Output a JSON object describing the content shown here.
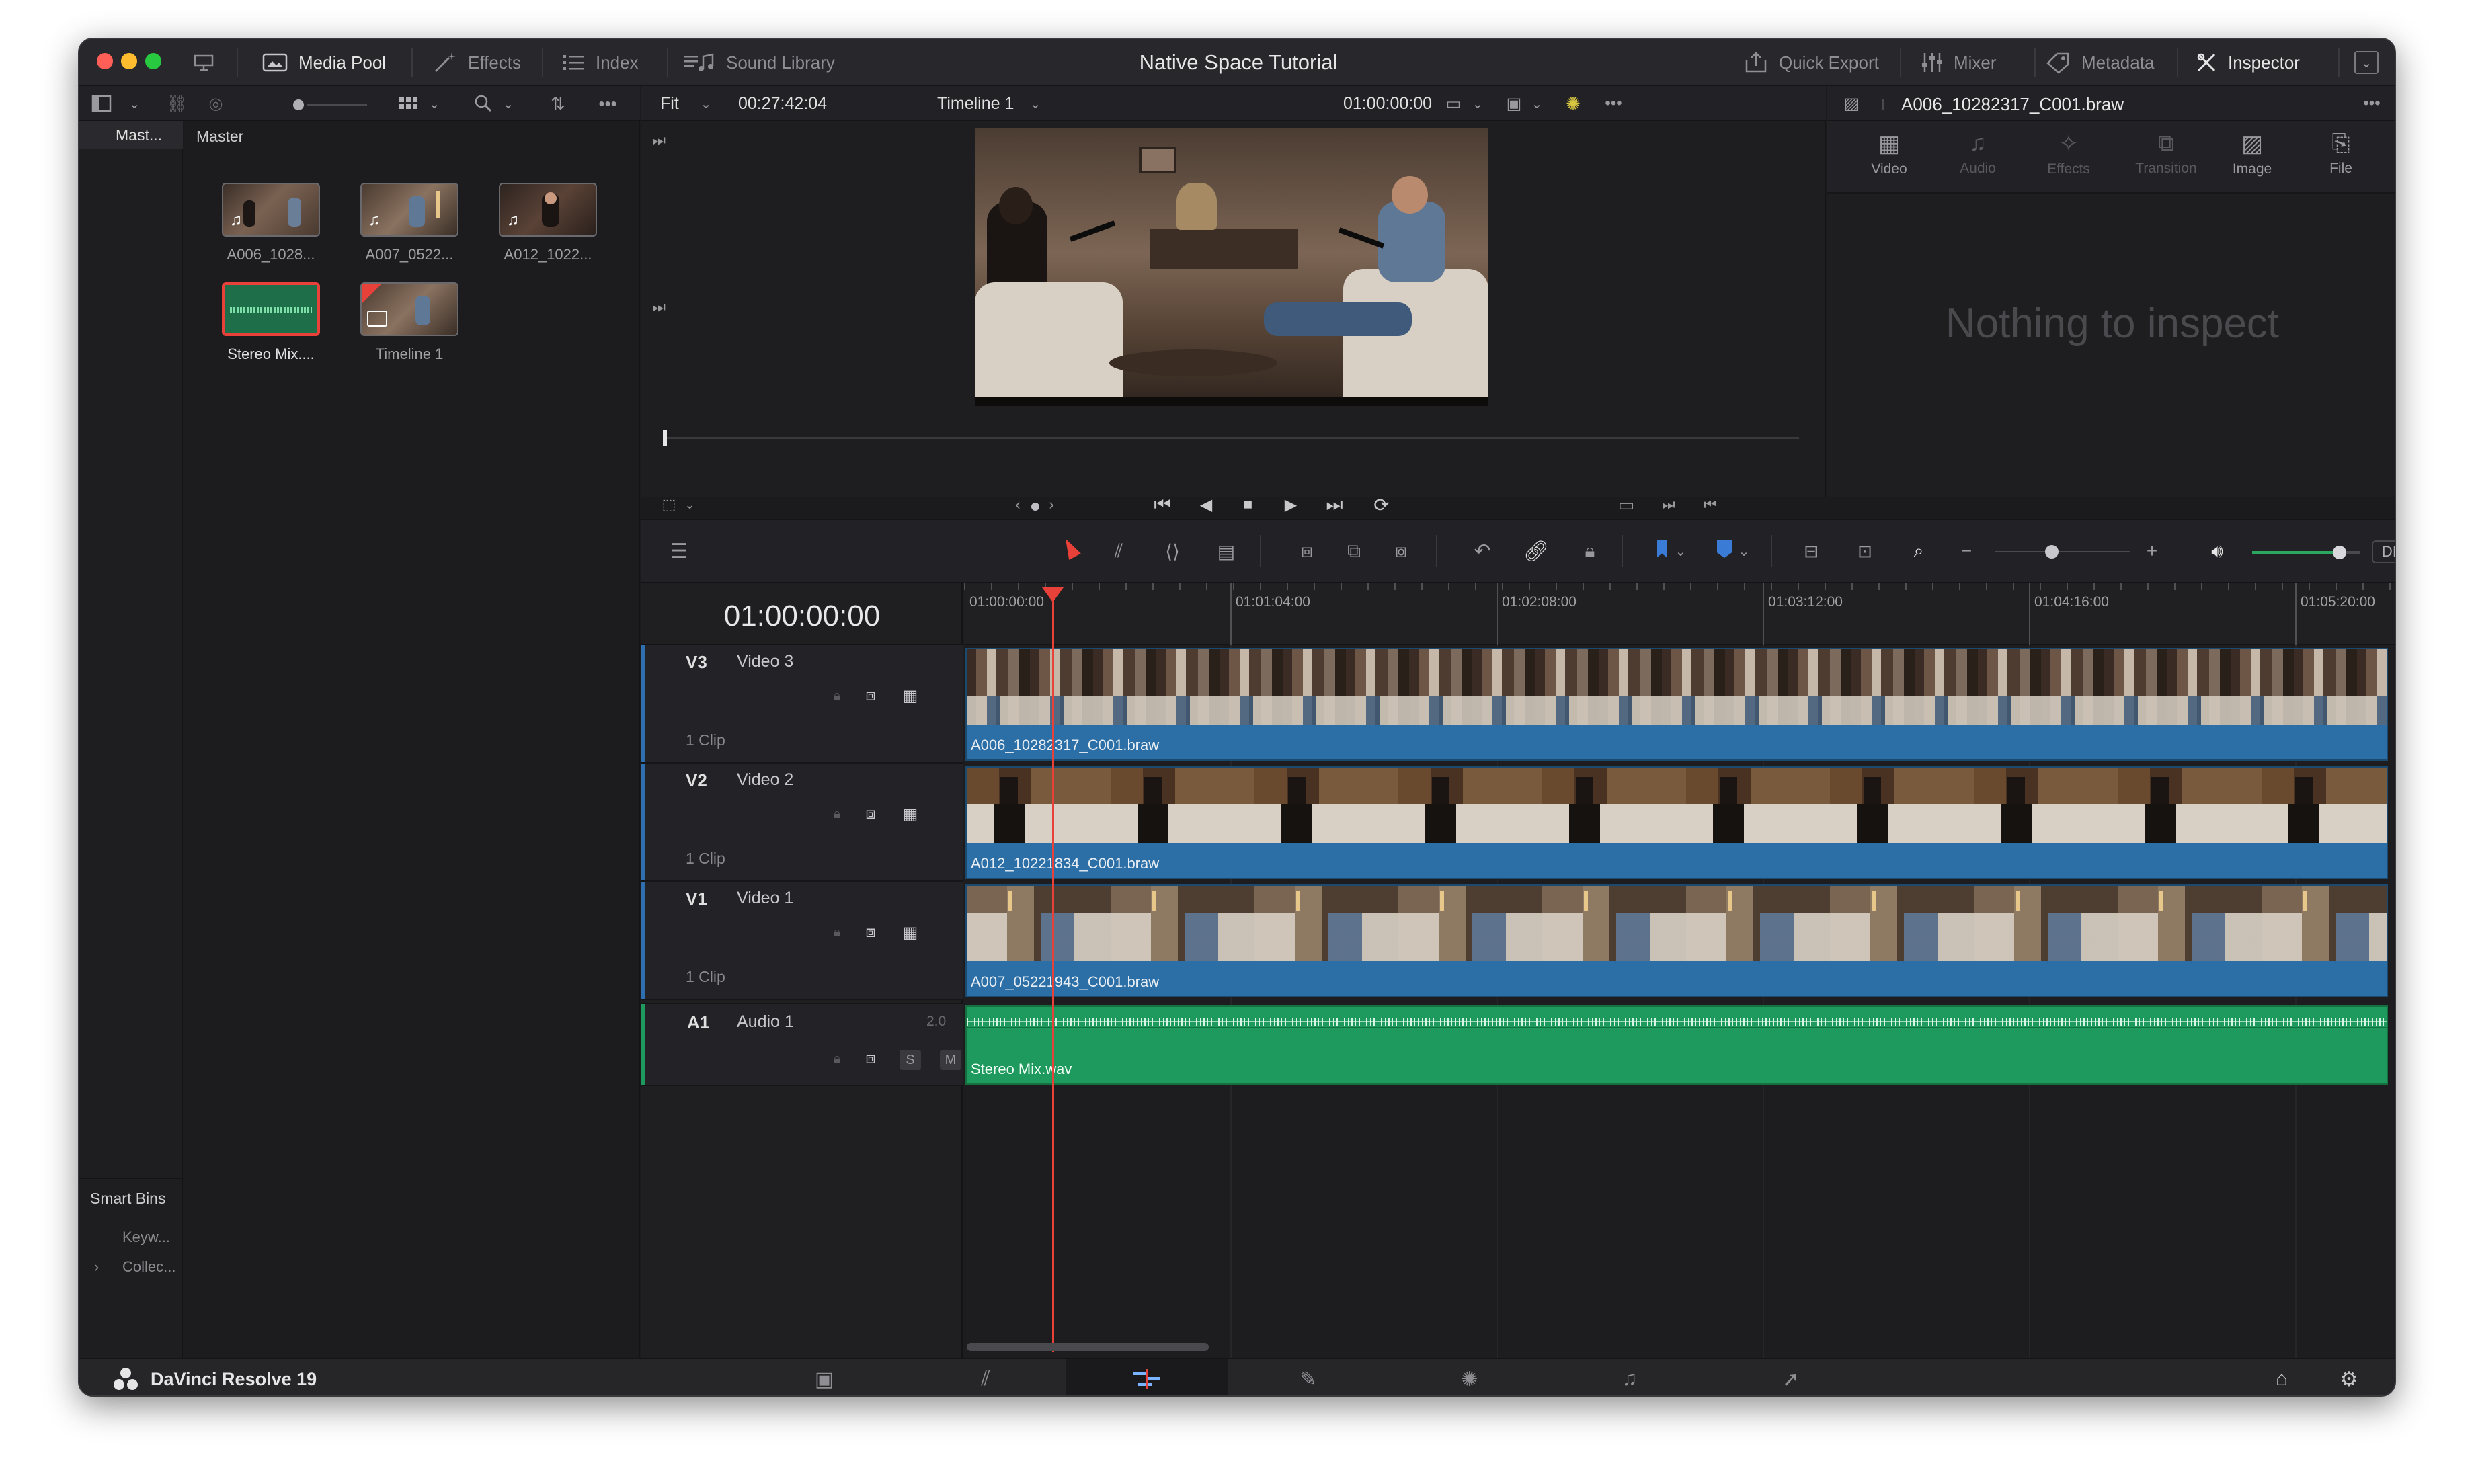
{
  "window": {
    "title": "Native Space Tutorial"
  },
  "toolbar": {
    "left": [
      {
        "icon": "media-pool-icon",
        "label": "Media Pool"
      },
      {
        "icon": "effects-wand-icon",
        "label": "Effects"
      },
      {
        "icon": "index-list-icon",
        "label": "Index"
      },
      {
        "icon": "sound-library-icon",
        "label": "Sound Library"
      }
    ],
    "right": [
      {
        "icon": "quick-export-icon",
        "label": "Quick Export"
      },
      {
        "icon": "mixer-sliders-icon",
        "label": "Mixer"
      },
      {
        "icon": "metadata-tag-icon",
        "label": "Metadata"
      },
      {
        "icon": "inspector-icon",
        "label": "Inspector"
      }
    ]
  },
  "media_pool": {
    "bin_tab": "Mast...",
    "bin_title": "Master",
    "clips": [
      {
        "name": "A006_1028...",
        "kind": "video-audio"
      },
      {
        "name": "A007_0522...",
        "kind": "video-audio"
      },
      {
        "name": "A012_1022...",
        "kind": "video-audio"
      },
      {
        "name": "Stereo Mix....",
        "kind": "audio",
        "selected": true
      },
      {
        "name": "Timeline 1",
        "kind": "timeline"
      }
    ],
    "smart_bins": {
      "title": "Smart Bins",
      "items": [
        "Keyw...",
        "Collec..."
      ]
    }
  },
  "viewer": {
    "zoom": "Fit",
    "source_timecode": "00:27:42:04",
    "timeline_name": "Timeline 1",
    "record_timecode": "01:00:00:00",
    "progress": 0.005
  },
  "inspector": {
    "clip_name": "A006_10282317_C001.braw",
    "tabs": [
      "Video",
      "Audio",
      "Effects",
      "Transition",
      "Image",
      "File"
    ],
    "empty_message": "Nothing to inspect"
  },
  "timeline": {
    "current_timecode": "01:00:00:00",
    "ruler": [
      "01:00:00:00",
      "01:01:04:00",
      "01:02:08:00",
      "01:03:12:00",
      "01:04:16:00",
      "01:05:20:00"
    ],
    "dim_label": "DIM",
    "tracks": [
      {
        "id": "V3",
        "name": "Video 3",
        "clips_label": "1 Clip",
        "clip": "A006_10282317_C001.braw"
      },
      {
        "id": "V2",
        "name": "Video 2",
        "clips_label": "1 Clip",
        "clip": "A012_10221834_C001.braw"
      },
      {
        "id": "V1",
        "name": "Video 1",
        "clips_label": "1 Clip",
        "clip": "A007_05221943_C001.braw"
      }
    ],
    "audio": {
      "id": "A1",
      "name": "Audio 1",
      "channels": "2.0",
      "clip": "Stereo Mix.wav",
      "solo": "S",
      "mute": "M"
    }
  },
  "footer": {
    "app_name": "DaVinci Resolve 19"
  },
  "colors": {
    "accent_red": "#e8413a",
    "video_clip": "#2b6fa6",
    "audio_clip": "#1f9a5f"
  }
}
